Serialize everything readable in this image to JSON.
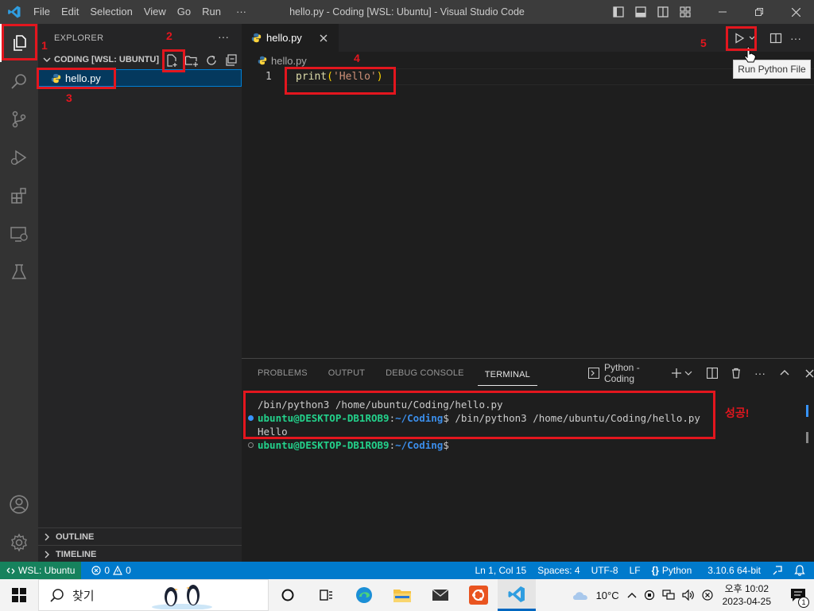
{
  "titlebar": {
    "menu": [
      "File",
      "Edit",
      "Selection",
      "View",
      "Go",
      "Run",
      "···"
    ],
    "title": "hello.py - Coding [WSL: Ubuntu] - Visual Studio Code"
  },
  "sidebar": {
    "title": "EXPLORER",
    "more": "···",
    "folder": "CODING [WSL: UBUNTU]",
    "file": "hello.py",
    "outline": "OUTLINE",
    "timeline": "TIMELINE"
  },
  "editor": {
    "tab_label": "hello.py",
    "breadcrumb": "hello.py",
    "line_number": "1",
    "code_fn": "print",
    "code_paren_open": "(",
    "code_str": "'Hello'",
    "code_paren_close": ")",
    "tooltip": "Run Python File"
  },
  "panel": {
    "tabs": [
      "PROBLEMS",
      "OUTPUT",
      "DEBUG CONSOLE",
      "TERMINAL"
    ],
    "terminal_name": "Python - Coding",
    "lines": {
      "cmd1": "/bin/python3 /home/ubuntu/Coding/hello.py",
      "user": "ubuntu@DESKTOP-DB1ROB9",
      "sep": ":",
      "path": "~/Coding",
      "prompt_cmd": "$ /bin/python3 /home/ubuntu/Coding/hello.py",
      "output": "Hello",
      "prompt_end": "$"
    }
  },
  "annotations": {
    "n1": "1",
    "n2": "2",
    "n3": "3",
    "n4": "4",
    "n5": "5",
    "success": "성공!"
  },
  "statusbar": {
    "remote": "WSL: Ubuntu",
    "errors": "0",
    "warnings": "0",
    "position": "Ln 1, Col 15",
    "spaces": "Spaces: 4",
    "encoding": "UTF-8",
    "eol": "LF",
    "language": "Python",
    "interpreter": "3.10.6 64-bit"
  },
  "taskbar": {
    "search": "찾기",
    "weather": "10°C",
    "time": "오후 10:02",
    "date": "2023-04-25",
    "notifications": "1"
  },
  "colors": {
    "accent": "#007acc",
    "annotation": "#e3161e",
    "terminal_user": "#23d18b",
    "terminal_path": "#3b8eea",
    "string": "#ce9178",
    "function": "#dcdcaa"
  }
}
